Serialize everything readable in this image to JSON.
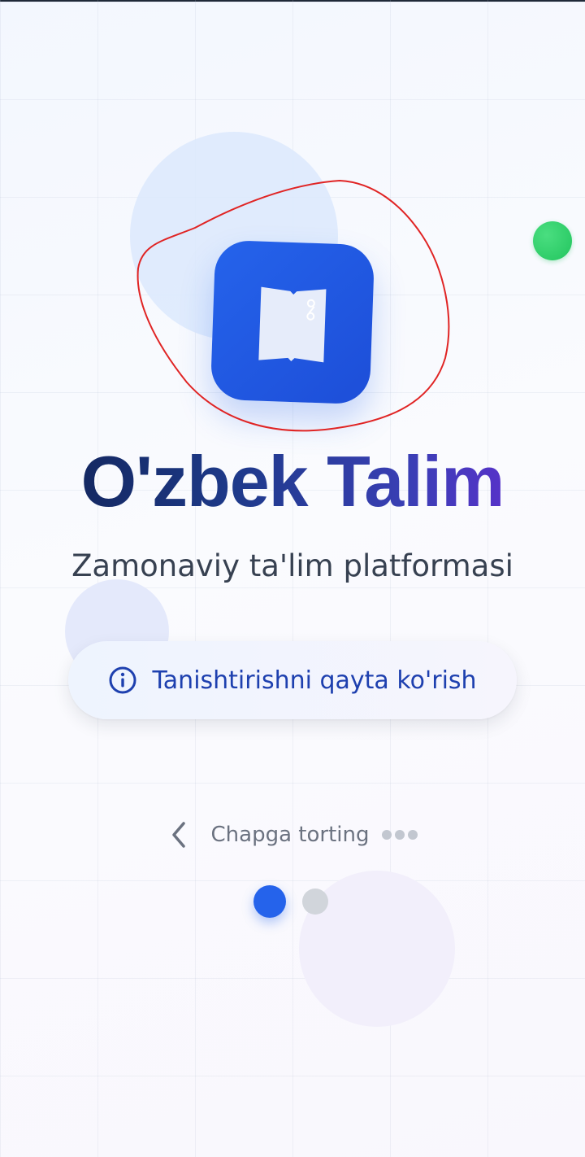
{
  "app": {
    "title": "O'zbek Talim",
    "subtitle": "Zamonaviy ta'lim platformasi"
  },
  "logo": {
    "icon": "open-book-icon",
    "color": "#2563eb"
  },
  "tour_button": {
    "icon": "info-circle-icon",
    "label": "Tanishtirishni qayta ko'rish"
  },
  "swipe_hint": {
    "icon": "chevron-left-icon",
    "text": "Chapga torting"
  },
  "pager": {
    "total": 2,
    "current": 1
  },
  "colors": {
    "accent": "#2563eb",
    "status_dot": "#22c55e",
    "annotation": "#e02424"
  }
}
